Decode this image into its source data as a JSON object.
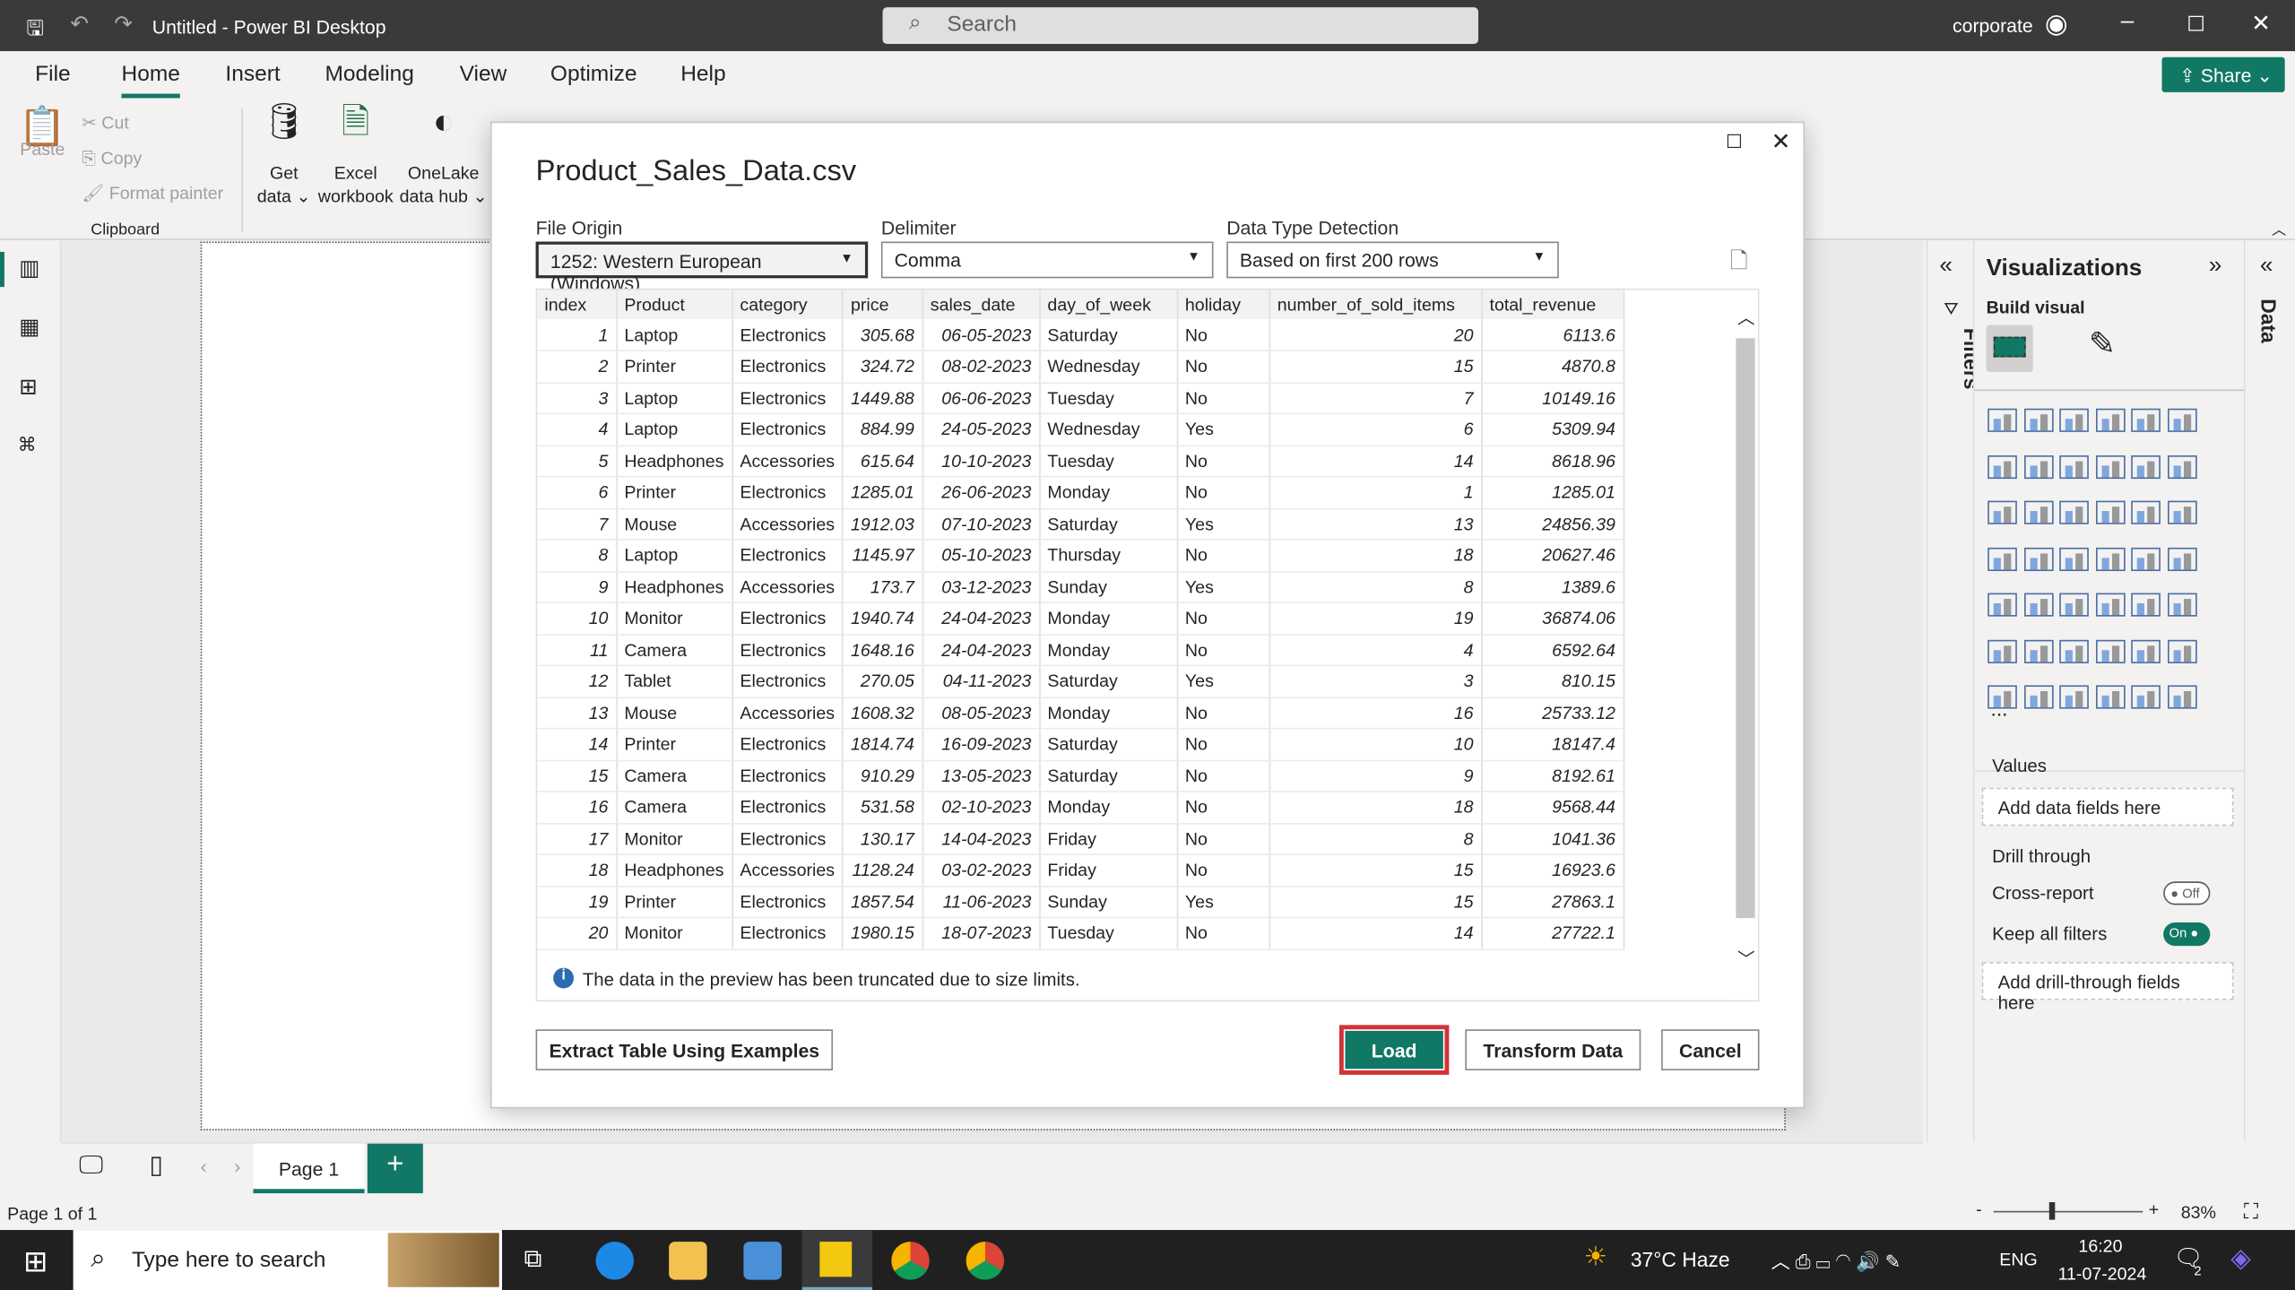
{
  "window": {
    "title": "Untitled - Power BI Desktop",
    "search_placeholder": "Search",
    "account": "corporate",
    "share": "Share"
  },
  "menu": [
    "File",
    "Home",
    "Insert",
    "Modeling",
    "View",
    "Optimize",
    "Help"
  ],
  "active_menu": "Home",
  "ribbon": {
    "paste": "Paste",
    "cut": "Cut",
    "copy": "Copy",
    "format_painter": "Format painter",
    "clipboard": "Clipboard",
    "get_data": "Get",
    "get_data2": "data",
    "excel": "Excel",
    "excel2": "workbook",
    "onelake": "OneLake",
    "onelake2": "data hub"
  },
  "dialog": {
    "title": "Product_Sales_Data.csv",
    "file_origin_label": "File Origin",
    "file_origin": "1252: Western European (Windows)",
    "delimiter_label": "Delimiter",
    "delimiter": "Comma",
    "detection_label": "Data Type Detection",
    "detection": "Based on first 200 rows",
    "columns": [
      "index",
      "Product",
      "category",
      "price",
      "sales_date",
      "day_of_week",
      "holiday",
      "number_of_sold_items",
      "total_revenue"
    ],
    "rows": [
      [
        "1",
        "Laptop",
        "Electronics",
        "305.68",
        "06-05-2023",
        "Saturday",
        "No",
        "20",
        "6113.6"
      ],
      [
        "2",
        "Printer",
        "Electronics",
        "324.72",
        "08-02-2023",
        "Wednesday",
        "No",
        "15",
        "4870.8"
      ],
      [
        "3",
        "Laptop",
        "Electronics",
        "1449.88",
        "06-06-2023",
        "Tuesday",
        "No",
        "7",
        "10149.16"
      ],
      [
        "4",
        "Laptop",
        "Electronics",
        "884.99",
        "24-05-2023",
        "Wednesday",
        "Yes",
        "6",
        "5309.94"
      ],
      [
        "5",
        "Headphones",
        "Accessories",
        "615.64",
        "10-10-2023",
        "Tuesday",
        "No",
        "14",
        "8618.96"
      ],
      [
        "6",
        "Printer",
        "Electronics",
        "1285.01",
        "26-06-2023",
        "Monday",
        "No",
        "1",
        "1285.01"
      ],
      [
        "7",
        "Mouse",
        "Accessories",
        "1912.03",
        "07-10-2023",
        "Saturday",
        "Yes",
        "13",
        "24856.39"
      ],
      [
        "8",
        "Laptop",
        "Electronics",
        "1145.97",
        "05-10-2023",
        "Thursday",
        "No",
        "18",
        "20627.46"
      ],
      [
        "9",
        "Headphones",
        "Accessories",
        "173.7",
        "03-12-2023",
        "Sunday",
        "Yes",
        "8",
        "1389.6"
      ],
      [
        "10",
        "Monitor",
        "Electronics",
        "1940.74",
        "24-04-2023",
        "Monday",
        "No",
        "19",
        "36874.06"
      ],
      [
        "11",
        "Camera",
        "Electronics",
        "1648.16",
        "24-04-2023",
        "Monday",
        "No",
        "4",
        "6592.64"
      ],
      [
        "12",
        "Tablet",
        "Electronics",
        "270.05",
        "04-11-2023",
        "Saturday",
        "Yes",
        "3",
        "810.15"
      ],
      [
        "13",
        "Mouse",
        "Accessories",
        "1608.32",
        "08-05-2023",
        "Monday",
        "No",
        "16",
        "25733.12"
      ],
      [
        "14",
        "Printer",
        "Electronics",
        "1814.74",
        "16-09-2023",
        "Saturday",
        "No",
        "10",
        "18147.4"
      ],
      [
        "15",
        "Camera",
        "Electronics",
        "910.29",
        "13-05-2023",
        "Saturday",
        "No",
        "9",
        "8192.61"
      ],
      [
        "16",
        "Camera",
        "Electronics",
        "531.58",
        "02-10-2023",
        "Monday",
        "No",
        "18",
        "9568.44"
      ],
      [
        "17",
        "Monitor",
        "Electronics",
        "130.17",
        "14-04-2023",
        "Friday",
        "No",
        "8",
        "1041.36"
      ],
      [
        "18",
        "Headphones",
        "Accessories",
        "1128.24",
        "03-02-2023",
        "Friday",
        "No",
        "15",
        "16923.6"
      ],
      [
        "19",
        "Printer",
        "Electronics",
        "1857.54",
        "11-06-2023",
        "Sunday",
        "Yes",
        "15",
        "27863.1"
      ],
      [
        "20",
        "Monitor",
        "Electronics",
        "1980.15",
        "18-07-2023",
        "Tuesday",
        "No",
        "14",
        "27722.1"
      ]
    ],
    "truncated_note": "The data in the preview has been truncated due to size limits.",
    "extract": "Extract Table Using Examples",
    "load": "Load",
    "transform": "Transform Data",
    "cancel": "Cancel"
  },
  "filters": "Filters",
  "visualizations": {
    "title": "Visualizations",
    "build": "Build visual",
    "more": "...",
    "values": "Values",
    "add_fields": "Add data fields here",
    "drill": "Drill through",
    "cross": "Cross-report",
    "cross_state": "Off",
    "keep": "Keep all filters",
    "keep_state": "On",
    "add_drill": "Add drill-through fields here",
    "icon_count": 42
  },
  "data_pane": "Data",
  "pages": {
    "tab": "Page 1",
    "add": "+"
  },
  "status": {
    "page": "Page 1 of 1",
    "zoom": "83%"
  },
  "taskbar": {
    "search": "Type here to search",
    "weather": "37°C  Haze",
    "lang": "ENG",
    "time": "16:20",
    "date": "11-07-2024",
    "notif": "2"
  },
  "colors": {
    "accent": "#117865",
    "load_border": "#d13438"
  }
}
